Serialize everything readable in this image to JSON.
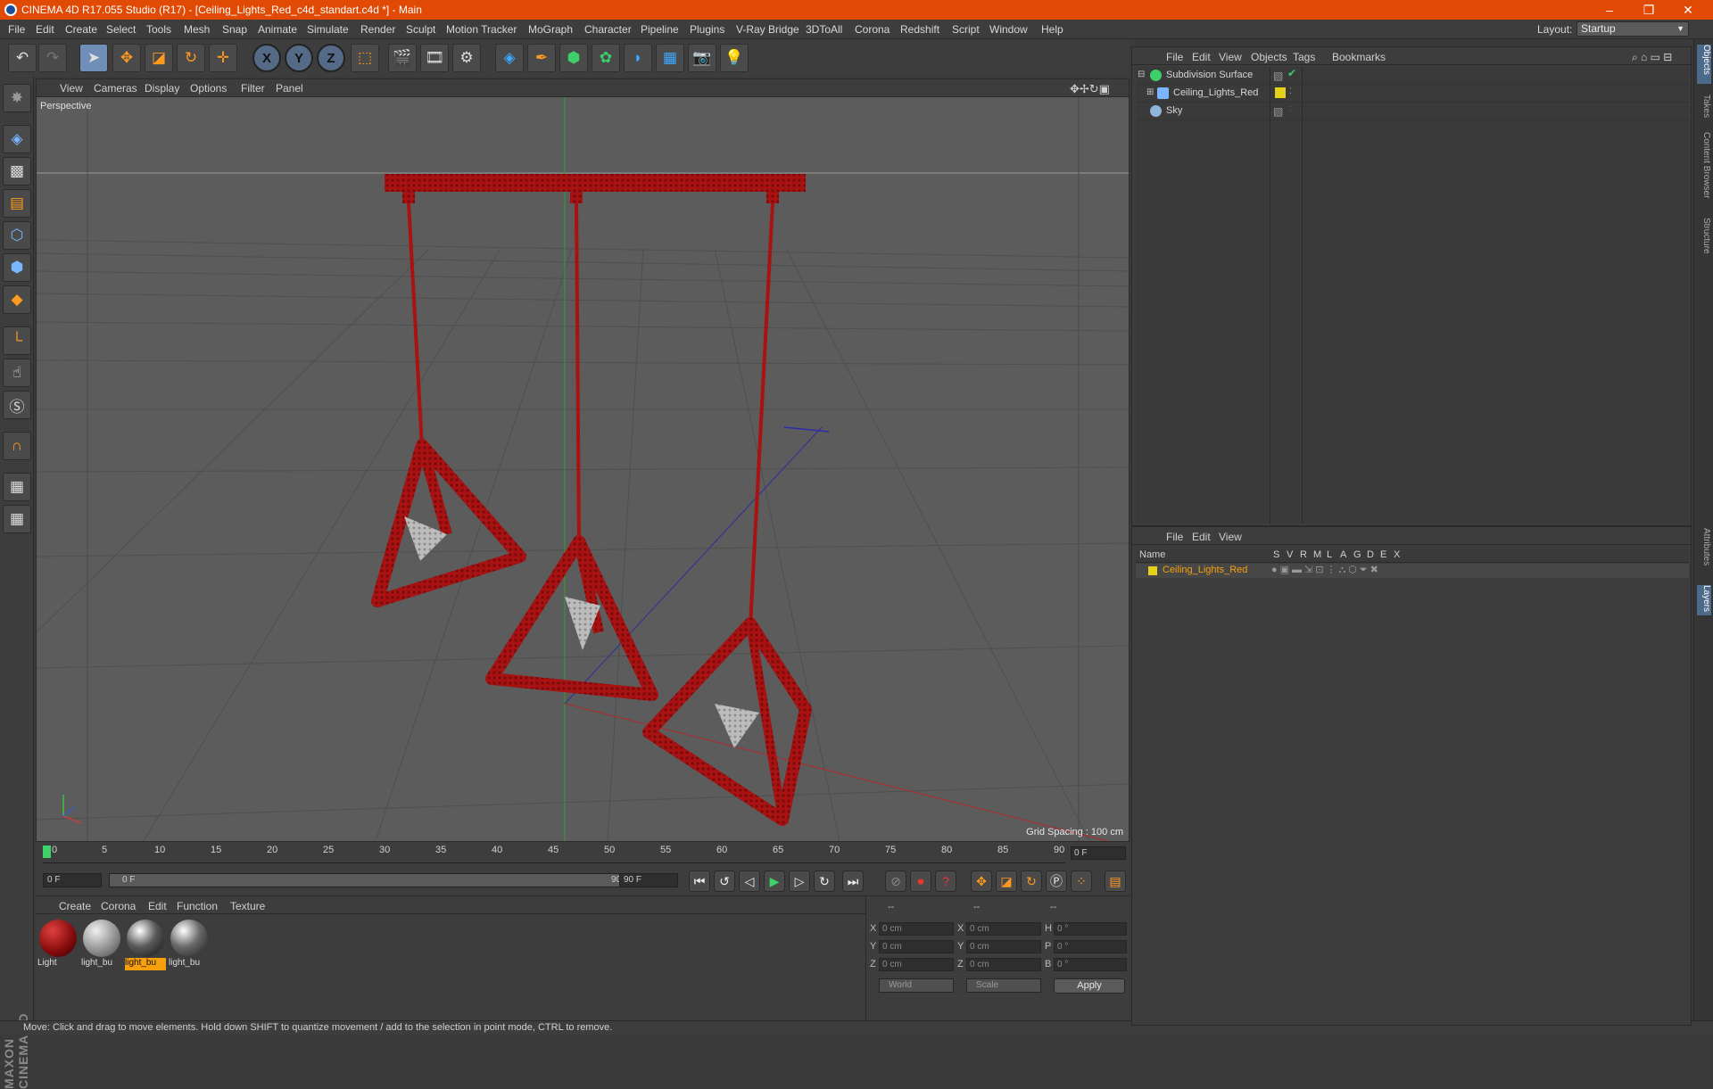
{
  "window": {
    "title": "CINEMA 4D R17.055 Studio (R17) - [Ceiling_Lights_Red_c4d_standart.c4d *] - Main",
    "controls": [
      "–",
      "❐",
      "✕"
    ]
  },
  "menubar": {
    "items": [
      "File",
      "Edit",
      "Create",
      "Select",
      "Tools",
      "Mesh",
      "Snap",
      "Animate",
      "Simulate",
      "Render",
      "Sculpt",
      "Motion Tracker",
      "MoGraph",
      "Character",
      "Pipeline",
      "Plugins",
      "V-Ray Bridge",
      "3DToAll",
      "Corona",
      "Redshift",
      "Script",
      "Window",
      "Help"
    ],
    "layout_label": "Layout:",
    "layout_value": "Startup"
  },
  "viewport": {
    "menu": [
      "View",
      "Cameras",
      "Display",
      "Options",
      "Filter",
      "Panel"
    ],
    "camera_label": "Perspective",
    "grid_spacing": "Grid Spacing : 100 cm"
  },
  "timeline": {
    "ticks": [
      "0",
      "5",
      "10",
      "15",
      "20",
      "25",
      "30",
      "35",
      "40",
      "45",
      "50",
      "55",
      "60",
      "65",
      "70",
      "75",
      "80",
      "85",
      "90"
    ],
    "current_frame": "0 F",
    "start_field": "0 F",
    "range_start": "0 F",
    "range_end": "90 F",
    "end_field": "90 F"
  },
  "material_manager": {
    "menu": [
      "Create",
      "Corona",
      "Edit",
      "Function",
      "Texture"
    ],
    "materials": [
      {
        "label": "Light",
        "color": "#8a0d0d"
      },
      {
        "label": "light_bu",
        "color": "#9a9a9a"
      },
      {
        "label": "light_bu",
        "color": "#5a5a5a"
      },
      {
        "label": "light_bu",
        "color": "#6a6a6a"
      }
    ]
  },
  "coordinates": {
    "headers": [
      "--",
      "--",
      "--"
    ],
    "rows": [
      {
        "a": "X",
        "av": "0 cm",
        "b": "X",
        "bv": "0 cm",
        "c": "H",
        "cv": "0 °"
      },
      {
        "a": "Y",
        "av": "0 cm",
        "b": "Y",
        "bv": "0 cm",
        "c": "P",
        "cv": "0 °"
      },
      {
        "a": "Z",
        "av": "0 cm",
        "b": "Z",
        "bv": "0 cm",
        "c": "B",
        "cv": "0 °"
      }
    ],
    "mode_select": "World",
    "size_select": "Scale",
    "apply": "Apply"
  },
  "object_manager": {
    "menu": [
      "File",
      "Edit",
      "View",
      "Objects",
      "Tags",
      "Bookmarks"
    ],
    "objects": [
      {
        "name": "Subdivision Surface"
      },
      {
        "name": "Ceiling_Lights_Red"
      },
      {
        "name": "Sky"
      }
    ]
  },
  "layer_manager": {
    "menu": [
      "File",
      "Edit",
      "View"
    ],
    "columns": [
      "Name",
      "S",
      "V",
      "R",
      "M",
      "L",
      "A",
      "G",
      "D",
      "E",
      "X"
    ],
    "layer_name": "Ceiling_Lights_Red"
  },
  "right_tabs": [
    "Objects",
    "Takes",
    "Content Browser",
    "Structure",
    "Attributes",
    "Layers"
  ],
  "status": "Move: Click and drag to move elements. Hold down SHIFT to quantize movement / add to the selection in point mode, CTRL to remove.",
  "colors": {
    "title_bar": "#e04a05",
    "model_red": "#b01414",
    "accent_orange": "#f5a00c"
  }
}
